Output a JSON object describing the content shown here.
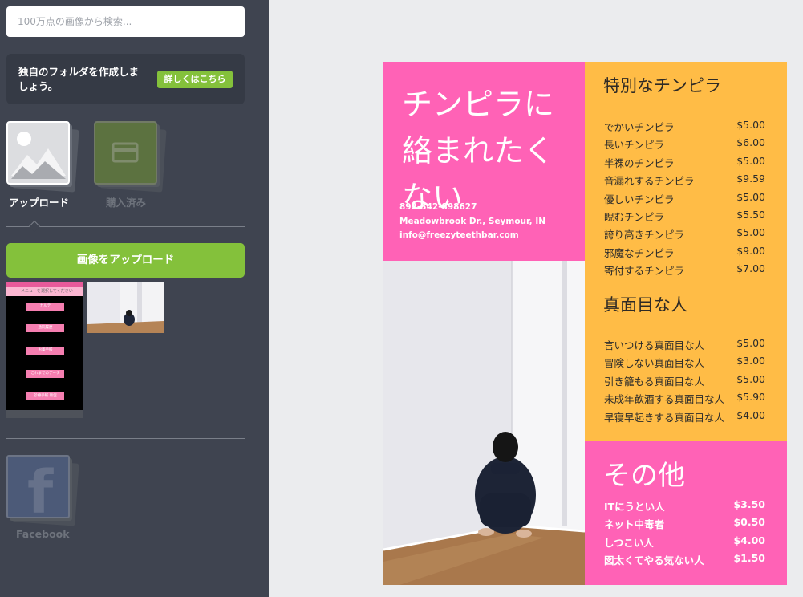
{
  "sidebar": {
    "search": {
      "placeholder": "100万点の画像から検索..."
    },
    "folder_promo": {
      "text": "独自のフォルダを作成しましょう。",
      "button": "詳しくはこちら"
    },
    "sources": {
      "upload_label": "アップロード",
      "purchased_label": "購入済み"
    },
    "upload_button": "画像をアップロード",
    "thumb_phone": {
      "header": "メニューを選択してください",
      "buttons": [
        "カルテ",
        "通院履歴",
        "お薬手帳",
        "これまでのデータ",
        "診療手帳 販促"
      ]
    },
    "facebook": {
      "label": "Facebook",
      "glyph": "f"
    }
  },
  "flyer": {
    "headline": "チンピラに絡まれたくない",
    "phone": "892-342-898627",
    "address": "Meadowbrook Dr., Seymour, IN",
    "email": "info@freezyteethbar.com",
    "section1": {
      "title": "特別なチンピラ",
      "items": [
        {
          "name": "でかいチンピラ",
          "price": "$5.00"
        },
        {
          "name": "長いチンピラ",
          "price": "$6.00"
        },
        {
          "name": "半裸のチンピラ",
          "price": "$5.00"
        },
        {
          "name": "音漏れするチンピラ",
          "price": "$9.59"
        },
        {
          "name": "優しいチンピラ",
          "price": "$5.00"
        },
        {
          "name": "睨むチンピラ",
          "price": "$5.50"
        },
        {
          "name": "誇り高きチンピラ",
          "price": "$5.00"
        },
        {
          "name": "邪魔なチンピラ",
          "price": "$9.00"
        },
        {
          "name": "寄付するチンピラ",
          "price": "$7.00"
        }
      ]
    },
    "section2": {
      "title": "真面目な人",
      "items": [
        {
          "name": "言いつける真面目な人",
          "price": "$5.00"
        },
        {
          "name": "冒険しない真面目な人",
          "price": "$3.00"
        },
        {
          "name": "引き籠もる真面目な人",
          "price": "$5.00"
        },
        {
          "name": "未成年飲酒する真面目な人",
          "price": "$5.90"
        },
        {
          "name": "早寝早起きする真面目な人",
          "price": "$4.00"
        }
      ]
    },
    "section3": {
      "title": "その他",
      "items": [
        {
          "name": "ITにうとい人",
          "price": "$3.50"
        },
        {
          "name": "ネット中毒者",
          "price": "$0.50"
        },
        {
          "name": "しつこい人",
          "price": "$4.00"
        },
        {
          "name": "図太くてやる気ない人",
          "price": "$1.50"
        }
      ]
    }
  },
  "colors": {
    "sidebar_bg": "#3f4450",
    "accent_green": "#84c13b",
    "flyer_pink": "#ff62b6",
    "flyer_yellow": "#ffbc46",
    "canvas_bg": "#ebecee"
  },
  "icons": {
    "upload_tab": "image-placeholder-icon",
    "purchased_tab": "credit-card-icon",
    "facebook_tab": "facebook-icon"
  }
}
